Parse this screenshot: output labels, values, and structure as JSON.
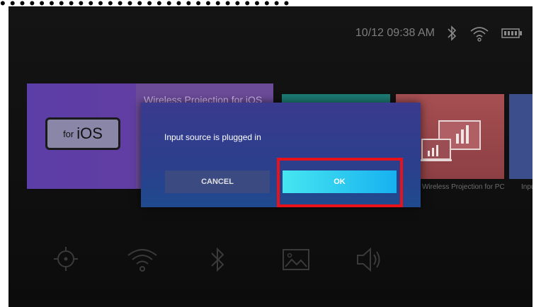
{
  "caption": "• • • • • • • • • • • • • • • • • • • • • • • • • • • • • •",
  "status_bar": {
    "datetime": "10/12 09:38 AM",
    "icons": [
      "bluetooth-icon",
      "wifi-icon",
      "battery-icon"
    ]
  },
  "tiles": [
    {
      "title": "Wireless Projection for iOS",
      "icon_text_small": "for",
      "icon_text_large": "iOS"
    },
    {
      "label": "Wireless Projection for PC"
    },
    {
      "label": "Input"
    }
  ],
  "dialog": {
    "message": "Input source is plugged in",
    "cancel_label": "CANCEL",
    "ok_label": "OK"
  },
  "bottom_icons": [
    "brightness-icon",
    "wifi-icon",
    "bluetooth-icon",
    "image-icon",
    "volume-icon"
  ],
  "colors": {
    "highlight": "#e8121a",
    "ok_button": "#17b1f0"
  }
}
